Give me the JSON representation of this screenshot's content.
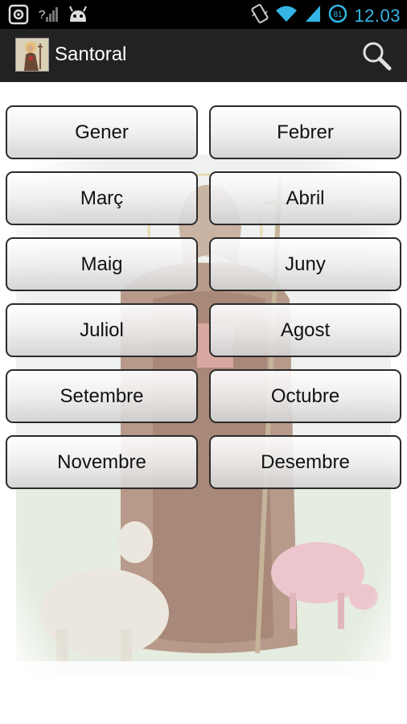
{
  "status_bar": {
    "time": "12.03",
    "battery_level": "81",
    "icons": [
      "screenshot-icon",
      "no-signal-icon",
      "android-debug-icon",
      "vibrate-icon",
      "wifi-icon",
      "cell-signal-icon",
      "battery-icon"
    ]
  },
  "action_bar": {
    "title": "Santoral",
    "app_icon": "saint-icon",
    "search_icon": "search-icon"
  },
  "months": [
    "Gener",
    "Febrer",
    "Març",
    "Abril",
    "Maig",
    "Juny",
    "Juliol",
    "Agost",
    "Setembre",
    "Octubre",
    "Novembre",
    "Desembre"
  ],
  "colors": {
    "status_bar_bg": "#000000",
    "action_bar_bg": "#222222",
    "clock": "#33b5e5",
    "button_border": "#2b2b2b"
  }
}
